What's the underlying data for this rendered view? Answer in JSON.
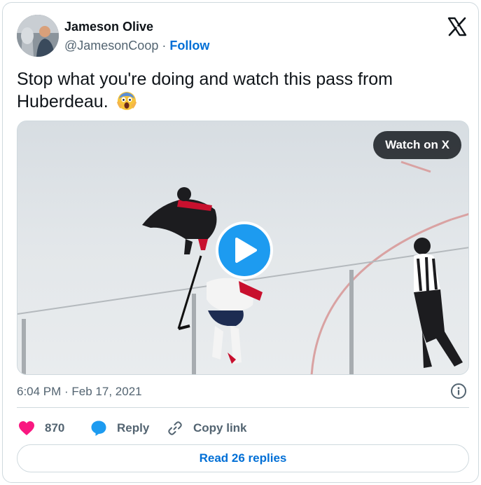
{
  "author": {
    "name": "Jameson Olive",
    "handle": "@JamesonCoop",
    "separator": " · ",
    "follow_label": "Follow"
  },
  "tweet": {
    "text": "Stop what you're doing and watch this pass from Huberdeau.",
    "emoji": "face-screaming-in-fear"
  },
  "media": {
    "watch_label": "Watch on X",
    "play_icon": "play-icon"
  },
  "meta": {
    "timestamp": "6:04 PM · Feb 17, 2021"
  },
  "actions": {
    "like_count": "870",
    "reply_label": "Reply",
    "copy_link_label": "Copy link"
  },
  "footer": {
    "read_replies_label": "Read 26 replies"
  },
  "colors": {
    "link": "#006fd6",
    "muted": "#536471",
    "like": "#f91880",
    "play": "#1d9bf0",
    "border": "#cfd9de"
  }
}
